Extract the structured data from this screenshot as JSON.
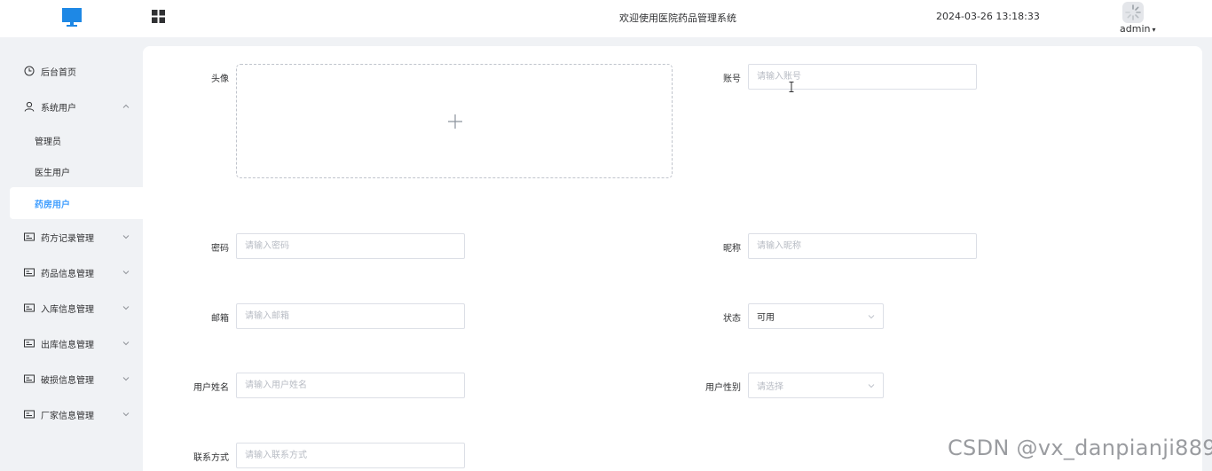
{
  "header": {
    "logo_icon": "monitor-icon",
    "apps_icon": "grid-icon",
    "title": "欢迎使用医院药品管理系统",
    "datetime": "2024-03-26 13:18:33",
    "username": "admin",
    "accent": "#409eff"
  },
  "sidebar": {
    "items": [
      {
        "label": "后台首页",
        "icon": "clock-icon"
      },
      {
        "label": "系统用户",
        "icon": "user-icon",
        "expanded": true,
        "children": [
          "管理员",
          "医生用户",
          "药房用户"
        ],
        "active_child": "药房用户"
      },
      {
        "label": "药方记录管理",
        "icon": "card-icon"
      },
      {
        "label": "药品信息管理",
        "icon": "card-icon"
      },
      {
        "label": "入库信息管理",
        "icon": "card-icon"
      },
      {
        "label": "出库信息管理",
        "icon": "card-icon"
      },
      {
        "label": "破损信息管理",
        "icon": "card-icon"
      },
      {
        "label": "厂家信息管理",
        "icon": "card-icon"
      }
    ]
  },
  "form": {
    "avatar": {
      "label": "头像"
    },
    "account": {
      "label": "账号",
      "placeholder": "请输入账号"
    },
    "password": {
      "label": "密码",
      "placeholder": "请输入密码"
    },
    "nickname": {
      "label": "昵称",
      "placeholder": "请输入昵称"
    },
    "email": {
      "label": "邮箱",
      "placeholder": "请输入邮箱"
    },
    "status": {
      "label": "状态",
      "value": "可用"
    },
    "real_name": {
      "label": "用户姓名",
      "placeholder": "请输入用户姓名"
    },
    "gender": {
      "label": "用户性别",
      "placeholder": "请选择"
    },
    "contact": {
      "label": "联系方式",
      "placeholder": "请输入联系方式"
    }
  },
  "watermark": "CSDN @vx_danpianji889"
}
